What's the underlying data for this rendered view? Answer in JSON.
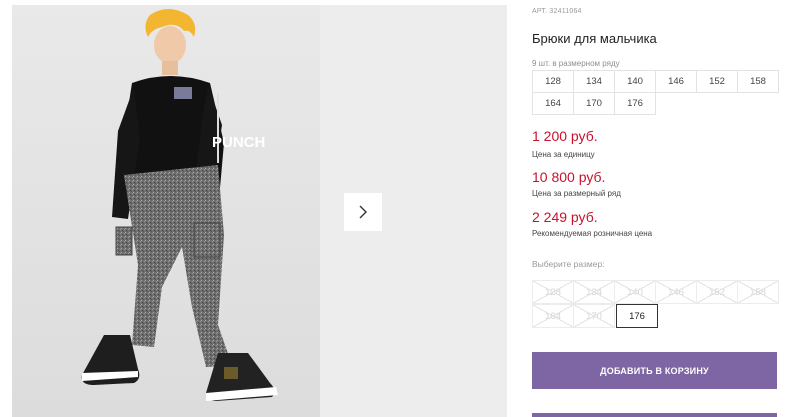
{
  "product": {
    "article": "АРТ. 32411064",
    "title": "Брюки для мальчика",
    "pack_note": "9 шт. в размерном ряду",
    "size_range": [
      "128",
      "134",
      "140",
      "146",
      "152",
      "158",
      "164",
      "170",
      "176"
    ]
  },
  "prices": {
    "unit_price": "1 200 руб.",
    "unit_label": "Цена за единицу",
    "pack_price": "10 800 руб.",
    "pack_label": "Цена за размерный ряд",
    "retail_price": "2 249 руб.",
    "retail_label": "Рекомендуемая розничная цена"
  },
  "size_select": {
    "label": "Выберите размер:",
    "options": [
      {
        "size": "128",
        "available": false
      },
      {
        "size": "134",
        "available": false
      },
      {
        "size": "140",
        "available": false
      },
      {
        "size": "146",
        "available": false
      },
      {
        "size": "152",
        "available": false
      },
      {
        "size": "158",
        "available": false
      },
      {
        "size": "164",
        "available": false
      },
      {
        "size": "170",
        "available": false
      },
      {
        "size": "176",
        "available": true,
        "selected": true
      }
    ]
  },
  "actions": {
    "add_to_cart": "ДОБАВИТЬ В КОРЗИНУ"
  },
  "gallery": {
    "next_icon": "chevron-right-icon",
    "print_text": "PUNCH"
  },
  "colors": {
    "price_red": "#c8122b",
    "button_purple": "#7e65a4"
  }
}
